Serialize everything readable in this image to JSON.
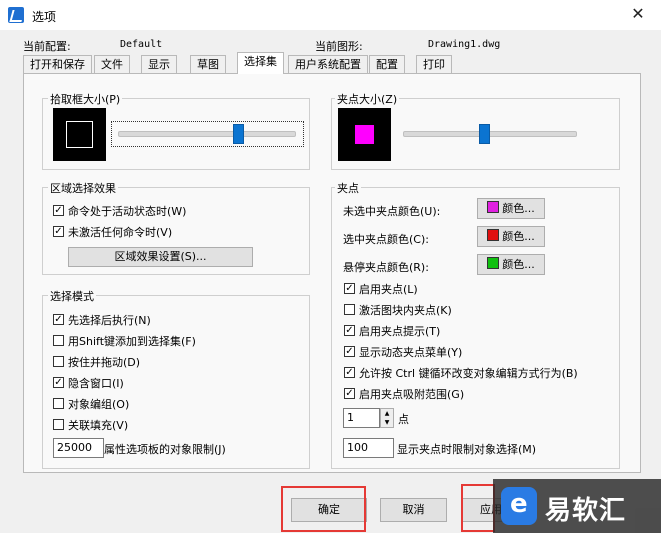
{
  "window": {
    "title": "选项",
    "close_glyph": "✕"
  },
  "header": {
    "current_profile_label": "当前配置:",
    "current_profile_value": "Default",
    "current_drawing_label": "当前图形:",
    "current_drawing_value": "Drawing1.dwg"
  },
  "tabs": [
    "打开和保存",
    "文件",
    "显示",
    "草图",
    "选择集",
    "用户系统配置",
    "配置",
    "打印"
  ],
  "active_tab": "选择集",
  "pickbox": {
    "title": "拾取框大小(P)",
    "slider_level": 0.68
  },
  "grip_size": {
    "title": "夹点大小(Z)",
    "slider_level": 0.47
  },
  "area_selection": {
    "title": "区域选择效果",
    "options": [
      {
        "label": "命令处于活动状态时(W)",
        "checked": true
      },
      {
        "label": "未激活任何命令时(V)",
        "checked": true
      }
    ],
    "settings_button": "区域效果设置(S)..."
  },
  "selection_modes": {
    "title": "选择模式",
    "options": [
      {
        "label": "先选择后执行(N)",
        "checked": true
      },
      {
        "label": "用Shift键添加到选择集(F)",
        "checked": false
      },
      {
        "label": "按住并拖动(D)",
        "checked": false
      },
      {
        "label": "隐含窗口(I)",
        "checked": true
      },
      {
        "label": "对象编组(O)",
        "checked": false
      },
      {
        "label": "关联填充(V)",
        "checked": false
      }
    ],
    "limit_value": "25000",
    "limit_label": "属性选项板的对象限制(J)"
  },
  "grips": {
    "title": "夹点",
    "colors": [
      {
        "label": "未选中夹点颜色(U):",
        "swatch": "#e020e0",
        "button": "颜色..."
      },
      {
        "label": "选中夹点颜色(C):",
        "swatch": "#e01010",
        "button": "颜色..."
      },
      {
        "label": "悬停夹点颜色(R):",
        "swatch": "#10c010",
        "button": "颜色..."
      }
    ],
    "options": [
      {
        "label": "启用夹点(L)",
        "checked": true
      },
      {
        "label": "激活图块内夹点(K)",
        "checked": false
      },
      {
        "label": "启用夹点提示(T)",
        "checked": true
      },
      {
        "label": "显示动态夹点菜单(Y)",
        "checked": true
      },
      {
        "label": "允许按 Ctrl 键循环改变对象编辑方式行为(B)",
        "checked": true
      },
      {
        "label": "启用夹点吸附范围(G)",
        "checked": true
      }
    ],
    "spin_value": "1",
    "spin_unit": "点",
    "grip_limit_value": "100",
    "grip_limit_label": "显示夹点时限制对象选择(M)"
  },
  "footer": {
    "ok": "确定",
    "cancel": "取消",
    "apply": "应用"
  },
  "watermark": {
    "text": "易软汇"
  },
  "colors": {
    "accent": "#0b74d1",
    "highlight": "#e53935",
    "grip": "#ff00ff"
  }
}
